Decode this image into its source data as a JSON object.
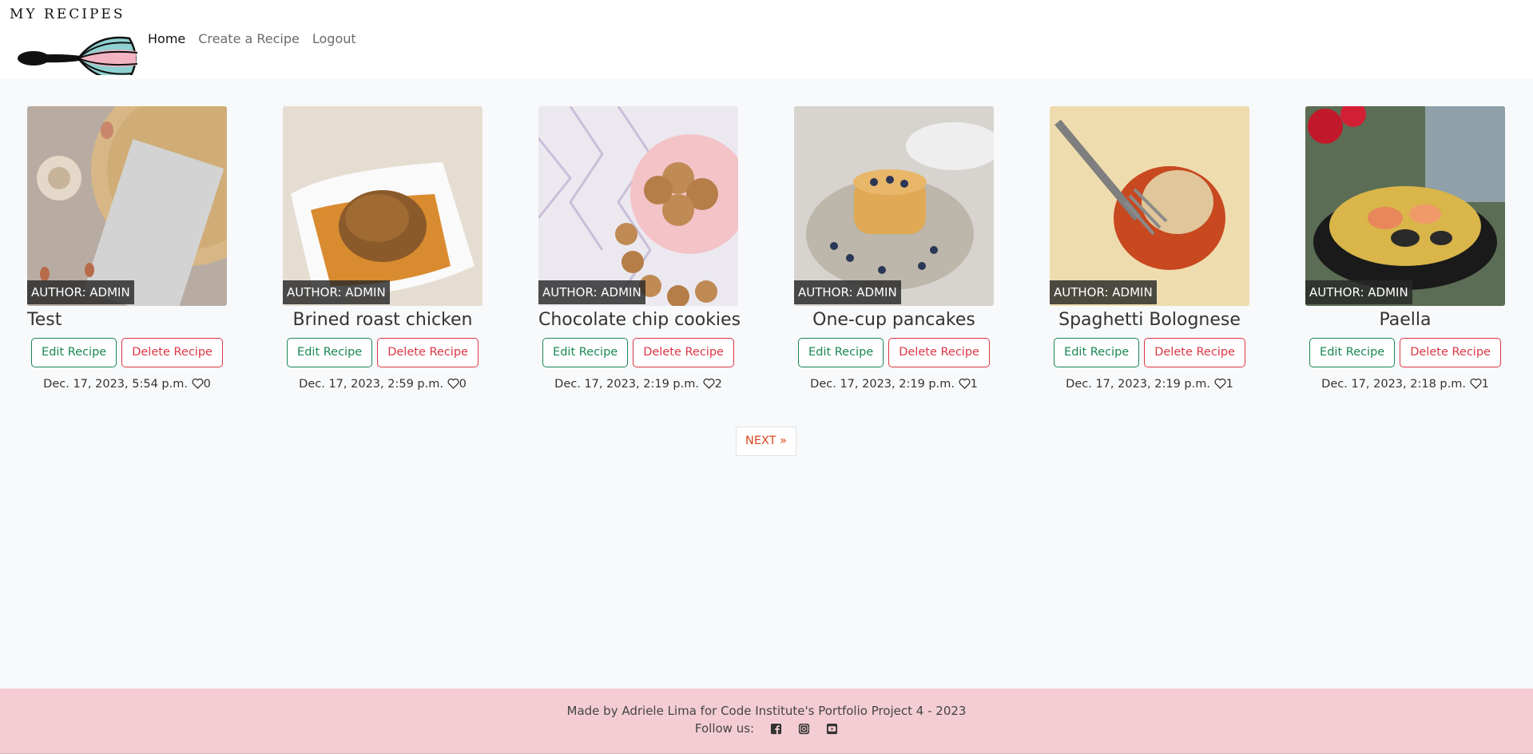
{
  "brand": {
    "title": "MY RECIPES"
  },
  "nav": {
    "home": "Home",
    "create": "Create a Recipe",
    "logout": "Logout"
  },
  "cards": [
    {
      "title": "Test",
      "author": "AUTHOR: ADMIN",
      "edit": "Edit Recipe",
      "delete": "Delete Recipe",
      "date": "Dec. 17, 2023, 5:54 p.m.",
      "likes": "0"
    },
    {
      "title": "Brined roast chicken",
      "author": "AUTHOR: ADMIN",
      "edit": "Edit Recipe",
      "delete": "Delete Recipe",
      "date": "Dec. 17, 2023, 2:59 p.m.",
      "likes": "0"
    },
    {
      "title": "Chocolate chip cookies",
      "author": "AUTHOR: ADMIN",
      "edit": "Edit Recipe",
      "delete": "Delete Recipe",
      "date": "Dec. 17, 2023, 2:19 p.m.",
      "likes": "2"
    },
    {
      "title": "One-cup pancakes",
      "author": "AUTHOR: ADMIN",
      "edit": "Edit Recipe",
      "delete": "Delete Recipe",
      "date": "Dec. 17, 2023, 2:19 p.m.",
      "likes": "1"
    },
    {
      "title": "Spaghetti Bolognese",
      "author": "AUTHOR: ADMIN",
      "edit": "Edit Recipe",
      "delete": "Delete Recipe",
      "date": "Dec. 17, 2023, 2:19 p.m.",
      "likes": "1"
    },
    {
      "title": "Paella",
      "author": "AUTHOR: ADMIN",
      "edit": "Edit Recipe",
      "delete": "Delete Recipe",
      "date": "Dec. 17, 2023, 2:18 p.m.",
      "likes": "1"
    }
  ],
  "pagination": {
    "next": "NEXT »"
  },
  "footer": {
    "credit": "Made by Adriele Lima for Code Institute's Portfolio Project 4 - 2023",
    "follow": "Follow us:",
    "icons": [
      "facebook-icon",
      "instagram-icon",
      "youtube-icon"
    ]
  },
  "colors": {
    "edit": "#198754",
    "delete": "#dc3545",
    "next": "#d9481c",
    "footer_bg": "#f4cdd4"
  }
}
